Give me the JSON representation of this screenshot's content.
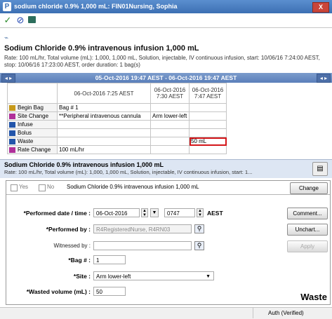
{
  "window": {
    "logo": "P",
    "title": "sodium chloride 0.9% 1,000 mL: FIN01Nursing, Sophia",
    "close_label": "X"
  },
  "order": {
    "name": "Sodium Chloride 0.9% intravenous infusion 1,000 mL",
    "details": "Rate: 100 mL/hr, Total volume (mL): 1,000, 1,000 mL, Solution, injectable, IV continuous infusion, start: 10/06/16 7:24:00 AEST, stop: 10/06/16 17:23:00 AEST, order duration: 1 bag(s)"
  },
  "date_range": "05-Oct-2016 19:47 AEST - 06-Oct-2016 19:47 AEST",
  "grid": {
    "columns": [
      "06-Oct-2016 7:25 AEST",
      "06-Oct-2016 7:30 AEST",
      "06-Oct-2016 7:47 AEST"
    ],
    "rows": [
      {
        "label": "Begin Bag",
        "cells": [
          "Bag # 1",
          "",
          ""
        ],
        "icon_color": "#b8860b"
      },
      {
        "label": "Site Change",
        "cells": [
          "**Peripheral intravenous cannula",
          "Arm lower-left",
          ""
        ],
        "icon_color": "#b0309a"
      },
      {
        "label": "Infuse",
        "cells": [
          "",
          "",
          ""
        ],
        "icon_color": "#2255aa"
      },
      {
        "label": "Bolus",
        "cells": [
          "",
          "",
          ""
        ],
        "icon_color": "#2255aa"
      },
      {
        "label": "Waste",
        "cells": [
          "",
          "",
          "50 mL"
        ],
        "icon_color": "#2255aa"
      },
      {
        "label": "Rate Change",
        "cells": [
          "100 mL/hr",
          "",
          ""
        ],
        "icon_color": "#b0309a"
      }
    ]
  },
  "order2": {
    "name": "Sodium Chloride 0.9% intravenous infusion 1,000 mL",
    "details": "Rate: 100 mL/hr, Total volume (mL): 1,000, 1,000 mL, Solution, injectable, IV continuous infusion, start: 1..."
  },
  "form": {
    "yes_label": "Yes",
    "no_label": "No",
    "order_name": "Sodium Chloride 0.9% intravenous infusion 1,000 mL",
    "change_label": "Change",
    "performed_date_label": "*Performed date / time :",
    "date_value": "06-Oct-2016",
    "time_value": "0747",
    "tz_label": "AEST",
    "comment_label": "Comment...",
    "performed_by_label": "*Performed by :",
    "performed_by_value": "R4RegisteredNurse, R4RN03",
    "unchart_label": "Unchart...",
    "witnessed_by_label": "Witnessed by :",
    "witnessed_by_value": "",
    "apply_label": "Apply",
    "bag_label": "*Bag # :",
    "bag_value": "1",
    "site_label": "*Site :",
    "site_value": "Arm lower-left",
    "wasted_label": "*Wasted volume (mL) :",
    "wasted_value": "50",
    "section_title": "Waste"
  },
  "footer": {
    "status": "Auth (Verified)"
  }
}
